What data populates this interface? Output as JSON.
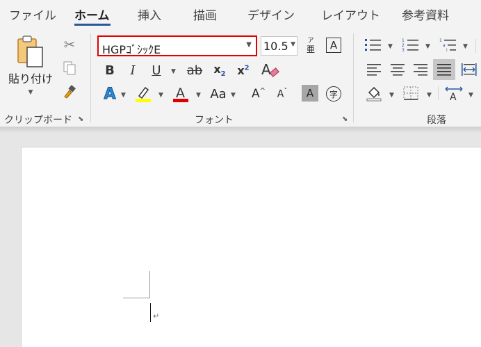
{
  "tabs": [
    {
      "label": "ファイル"
    },
    {
      "label": "ホーム"
    },
    {
      "label": "挿入"
    },
    {
      "label": "描画"
    },
    {
      "label": "デザイン"
    },
    {
      "label": "レイアウト"
    },
    {
      "label": "参考資料"
    }
  ],
  "clipboard": {
    "paste_label": "貼り付け",
    "group_label": "クリップボード"
  },
  "font": {
    "name": "HGPｺﾞｼｯｸE",
    "size": "10.5",
    "group_label": "フォント",
    "phonetic_top": "ア",
    "phonetic_bottom": "亜",
    "enclose": "字"
  },
  "paragraph": {
    "group_label": "段落"
  },
  "colors": {
    "accent": "#2b579a",
    "highlight": "#ffff00",
    "font_color": "#e00000",
    "outline": "#e00000"
  }
}
